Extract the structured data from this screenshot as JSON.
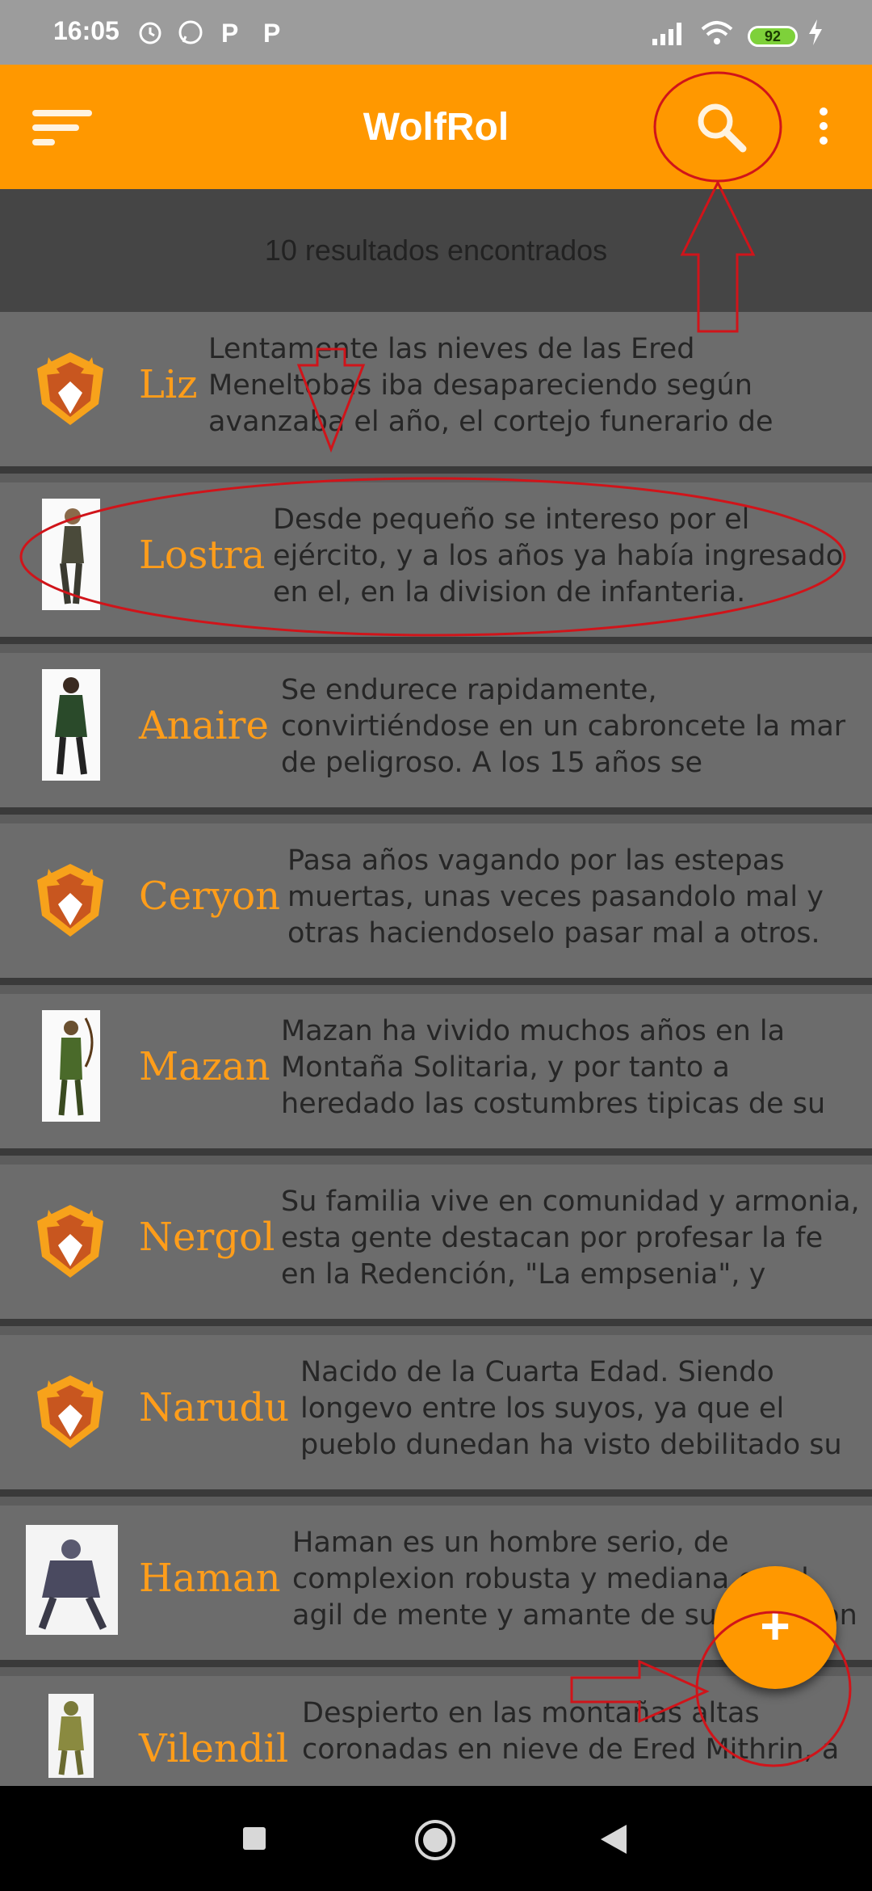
{
  "status_bar": {
    "time": "16:05",
    "battery": "92"
  },
  "app_bar": {
    "title": "WolfRol",
    "icons": [
      "menu-icon",
      "search-icon",
      "more-vert-icon"
    ]
  },
  "results": {
    "label": "10 resultados encontrados"
  },
  "items": [
    {
      "name": "Liz",
      "avatar": "wolf-logo",
      "description": "Lentamente las nieves de las Ered Meneltobas iba desapareciendo según avanzaba el año, el cortejo funerario de Anarel"
    },
    {
      "name": "Lostra",
      "avatar": "portrait",
      "description": "Desde pequeño se intereso por el ejército, y a los años ya había ingresado en el, en la division de infanteria."
    },
    {
      "name": "Anaire",
      "avatar": "portrait",
      "description": "Se endurece rapidamente, convirtiéndose en un cabroncete la mar de peligroso. A los 15 años se"
    },
    {
      "name": "Ceryon",
      "avatar": "wolf-logo",
      "description": "Pasa años vagando por las estepas muertas, unas veces pasandolo mal y otras haciendoselo pasar mal a otros."
    },
    {
      "name": "Mazan",
      "avatar": "portrait",
      "description": "Mazan ha vivido muchos años en la Montaña Solitaria, y por tanto a heredado las costumbres tipicas de su tierra. Luce"
    },
    {
      "name": "Nergol",
      "avatar": "wolf-logo",
      "description": "Su familia vive en comunidad y armonia, esta gente destacan por profesar la fe en la Redención, \"La empsenia\", y"
    },
    {
      "name": "Narudu",
      "avatar": "wolf-logo",
      "description": "Nacido de la Cuarta Edad. Siendo longevo entre los suyos, ya que el pueblo dunedan ha visto debilitado su"
    },
    {
      "name": "Haman",
      "avatar": "portrait",
      "description": "Haman es un hombre serio, de complexion robusta y mediana edad, agil de mente y amante de su profesion"
    },
    {
      "name": "Vilendil",
      "avatar": "portrait",
      "description": "Despierto en las montañas altas coronadas en nieve de Ered Mithrin, a"
    }
  ],
  "fab": {
    "label": "+"
  },
  "colors": {
    "accent": "#ff9800",
    "annotation": "#d0141a"
  }
}
